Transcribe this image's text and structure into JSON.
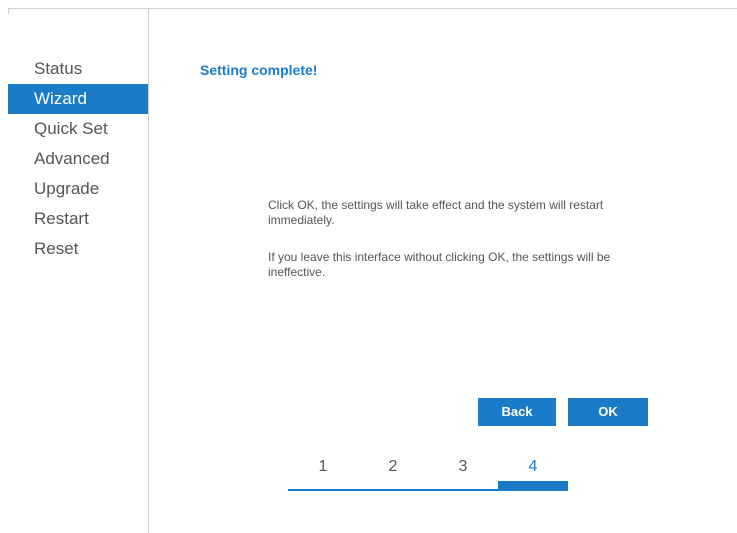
{
  "sidebar": {
    "items": [
      {
        "label": "Status",
        "active": false
      },
      {
        "label": "Wizard",
        "active": true
      },
      {
        "label": "Quick Set",
        "active": false
      },
      {
        "label": "Advanced",
        "active": false
      },
      {
        "label": "Upgrade",
        "active": false
      },
      {
        "label": "Restart",
        "active": false
      },
      {
        "label": "Reset",
        "active": false
      }
    ]
  },
  "main": {
    "title": "Setting complete!",
    "message_1": "Click OK, the settings will take effect and the system will restart immediately.",
    "message_2": "If you leave this interface without clicking OK, the settings will be ineffective.",
    "back_label": "Back",
    "ok_label": "OK"
  },
  "steps": {
    "labels": [
      "1",
      "2",
      "3",
      "4"
    ],
    "current": "4"
  },
  "colors": {
    "accent": "#1a7cc8",
    "text": "#555555",
    "border": "#cfcfcf"
  }
}
